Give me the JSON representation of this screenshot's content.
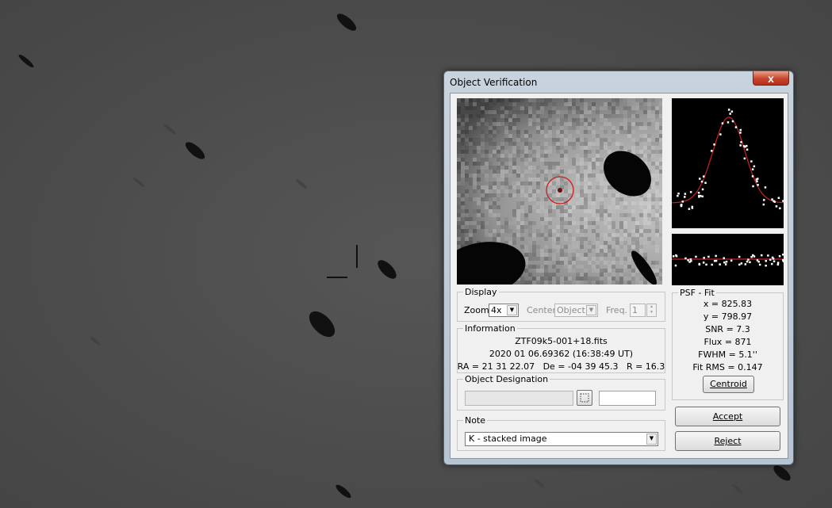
{
  "window": {
    "title": "Object Verification",
    "close_icon": "close-x-icon",
    "close_glyph": "x"
  },
  "display": {
    "legend": "Display",
    "zoom_label": "Zoom",
    "zoom_value": "4x",
    "center_label": "Center",
    "center_value": "Object",
    "freq_label": "Freq.",
    "freq_value": "1"
  },
  "information": {
    "legend": "Information",
    "filename": "ZTF09k5-001+18.fits",
    "datetime": "2020 01 06.69362 (16:38:49 UT)",
    "coords": "RA = 21 31 22.07   De = -04 39 45.3   R = 16.3"
  },
  "designation": {
    "legend": "Object Designation",
    "field_value": "",
    "extra_value": ""
  },
  "note": {
    "legend": "Note",
    "value": "K - stacked image"
  },
  "psf_fit": {
    "legend": "PSF - Fit",
    "x_line": "x = 825.83",
    "y_line": "y = 798.97",
    "snr_line": "SNR = 7.3",
    "flux_line": "Flux = 871",
    "fwhm_line": "FWHM = 5.1''",
    "fitrms_line": "Fit RMS = 0.147",
    "centroid_label": "Centroid"
  },
  "buttons": {
    "accept_label": "Accept",
    "reject_label": "Reject"
  },
  "colors": {
    "fit_curve": "#cc2222",
    "target_circle": "#d01818",
    "data_points": "#ffffff"
  }
}
